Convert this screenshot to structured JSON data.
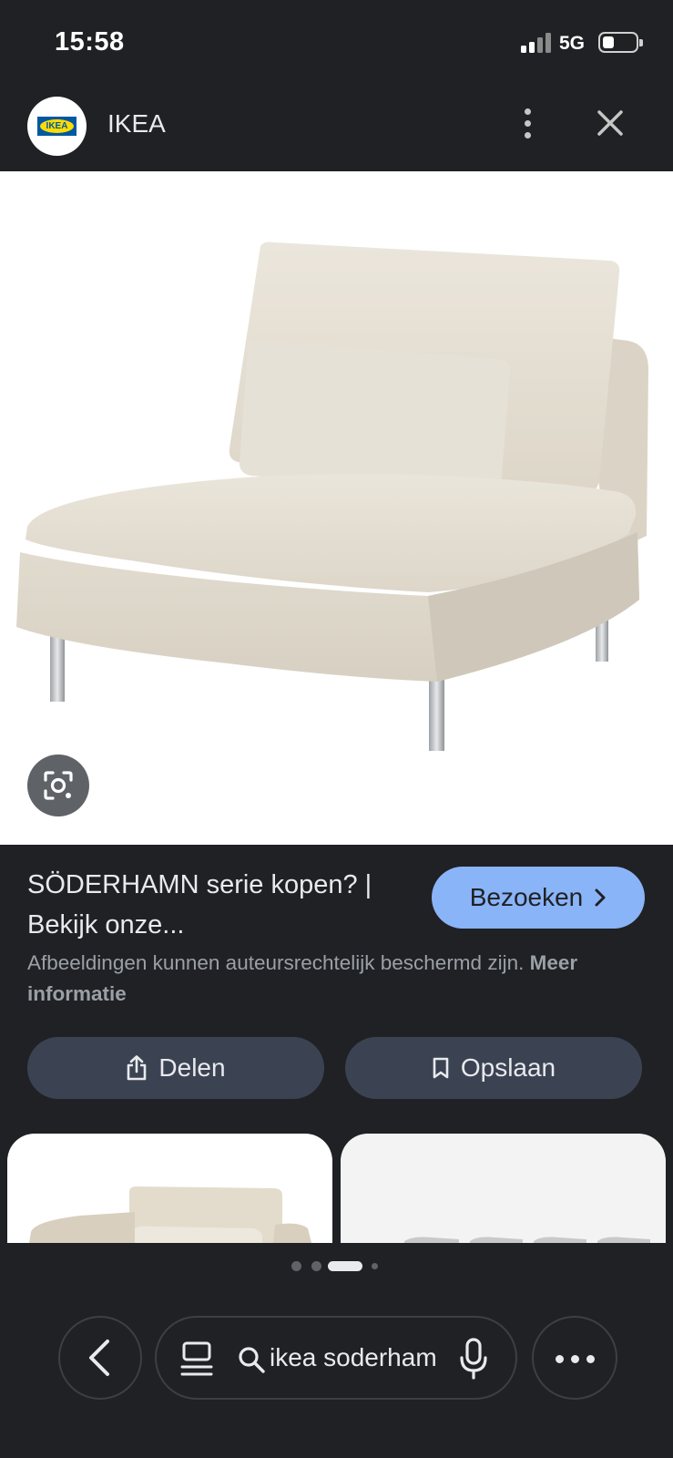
{
  "status_bar": {
    "time": "15:58",
    "network": "5G"
  },
  "header": {
    "site_name": "IKEA",
    "logo_text": "IKEA"
  },
  "result": {
    "title": "SÖDERHAMN serie kopen? | Bekijk onze...",
    "visit_label": "Bezoeken",
    "copyright_notice": "Afbeeldingen kunnen auteursrechtelijk beschermd zijn.",
    "more_info_label": "Meer informatie",
    "share_label": "Delen",
    "save_label": "Opslaan"
  },
  "bottom_bar": {
    "search_query": "ikea soderham",
    "active_page_dot": 3,
    "page_dot_count": 4
  },
  "colors": {
    "background": "#202124",
    "accent_button": "#8ab4f8",
    "action_button": "#3b4353",
    "sofa_fabric": "#e2dccf"
  },
  "icons": {
    "menu": "more-vert-icon",
    "close": "close-icon",
    "lens": "google-lens-icon",
    "visit": "chevron-right-icon",
    "share": "share-icon",
    "save": "bookmark-icon",
    "back": "back-arrow-icon",
    "tabs": "tabs-icon",
    "search": "search-icon",
    "mic": "microphone-icon",
    "more": "more-horiz-icon"
  }
}
